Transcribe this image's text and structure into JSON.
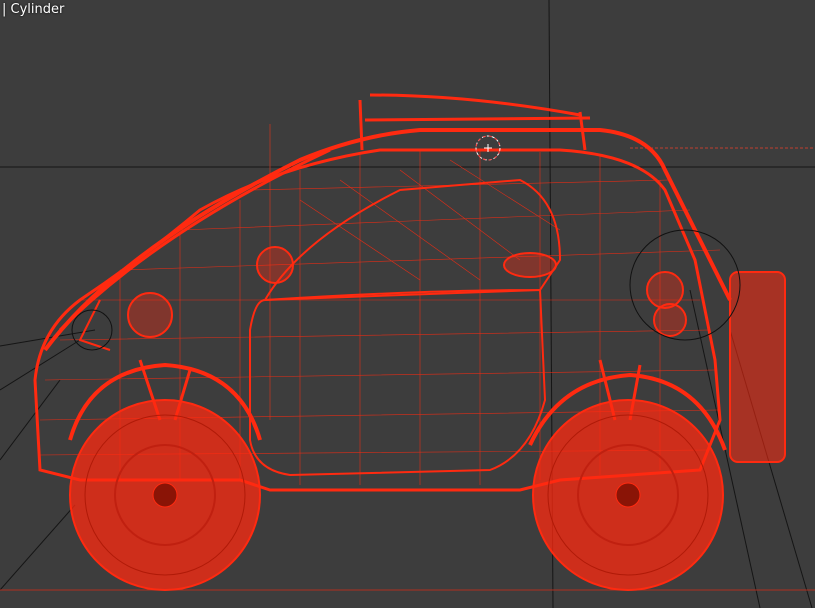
{
  "viewport": {
    "object_name": "Cylinder",
    "label_prefix": "| ",
    "background_color": "#3d3d3d",
    "wireframe_color": "#ff2a10",
    "guide_line_color": "#111111",
    "object_type": "vehicle-wireframe"
  }
}
